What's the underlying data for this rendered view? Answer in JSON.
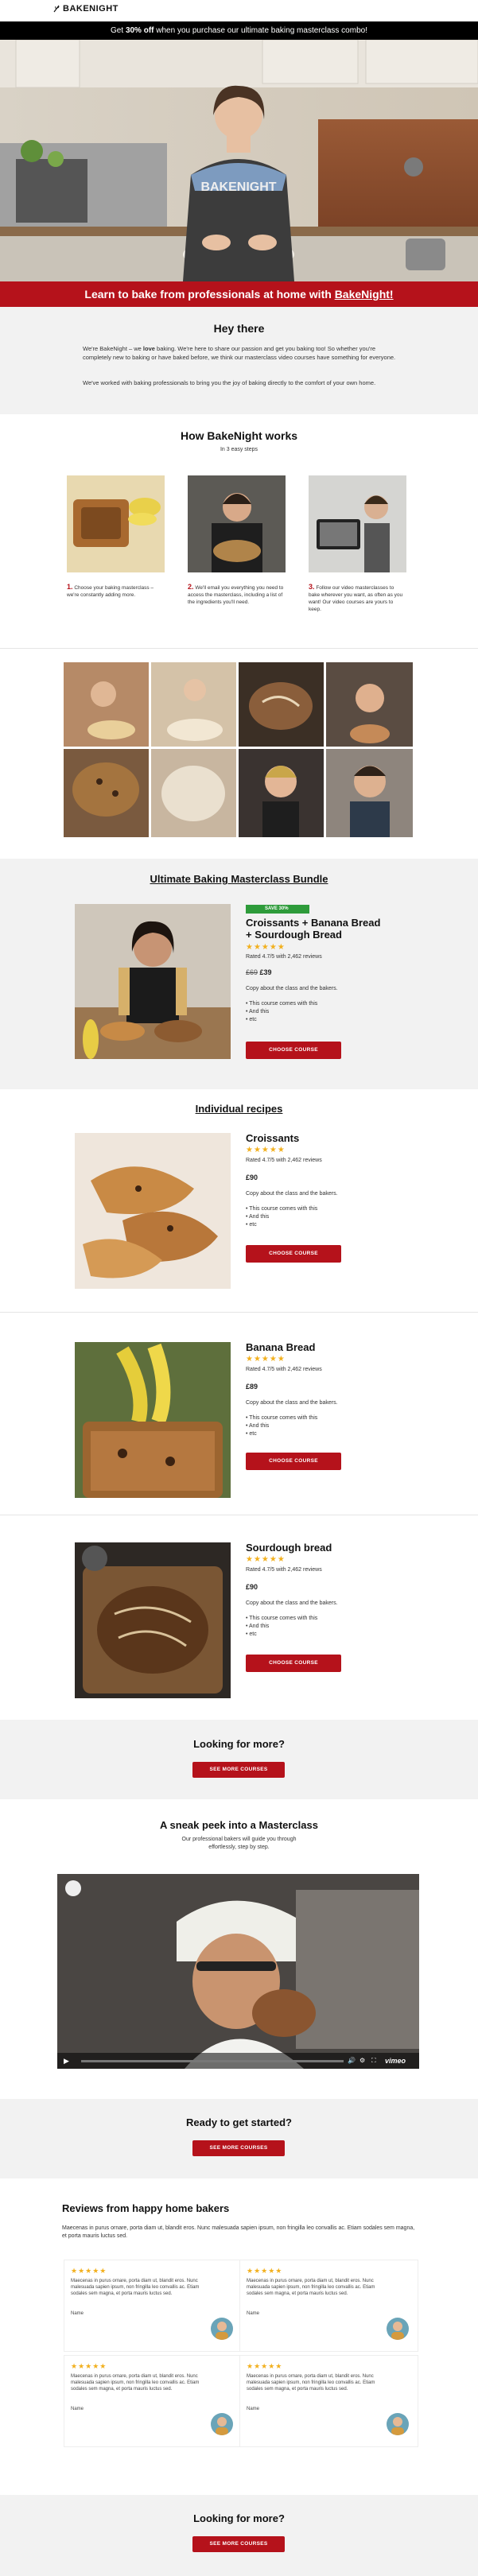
{
  "brand": {
    "name": "BAKENIGHT"
  },
  "promo": {
    "prefix": "Get ",
    "highlight": "30% off",
    "suffix": " when you purchase our ultimate baking masterclass combo!"
  },
  "hero": {
    "apron_text": "BAKENIGHT"
  },
  "banner": {
    "text": "Learn to bake from professionals at home with ",
    "link": "BakeNight!"
  },
  "intro": {
    "title": "Hey there",
    "p1_pre": "We're BakeNight – we ",
    "p1_bold": "love",
    "p1_post": " baking. We're here to share our passion and get you baking too! So whether you're completely new to baking or have baked before, we think our masterclass video courses have something for everyone.",
    "p2": "We've worked with baking professionals to bring you the joy of baking directly to the comfort of your own home."
  },
  "how": {
    "title": "How BakeNight works",
    "subtitle": "In 3 easy steps",
    "steps": [
      {
        "num": "1.",
        "text": "Choose your baking masterclass – we're constantly adding more."
      },
      {
        "num": "2.",
        "text": "We'll email you everything you need to access the masterclass, including a list of the ingredients you'll need."
      },
      {
        "num": "3.",
        "text": "Follow our video masterclasses to bake wherever you want, as often as you want! Our video courses are yours to keep."
      }
    ]
  },
  "bundle": {
    "heading": "Ultimate Baking Masterclass Bundle",
    "badge": "SAVE 30%",
    "title_line1": "Croissants + Banana Bread",
    "title_line2": "+ Sourdough Bread",
    "stars": "★★★★★",
    "rating": "Rated 4.7/5 with 2,462 reviews",
    "old_price": "£69",
    "price": "£39",
    "description": "Copy about the class and the bakers.",
    "bullets": [
      "This course comes with this",
      "And this",
      "etc"
    ],
    "button": "CHOOSE COURSE"
  },
  "individual": {
    "heading": "Individual recipes",
    "products": [
      {
        "title": "Croissants",
        "stars": "★★★★★",
        "rating": "Rated 4.7/5 with 2,462 reviews",
        "price": "£90",
        "description": "Copy about the class and the bakers.",
        "bullets": [
          "This course comes with this",
          "And this",
          "etc"
        ],
        "button": "CHOOSE COURSE"
      },
      {
        "title": "Banana Bread",
        "stars": "★★★★★",
        "rating": "Rated 4.7/5 with 2,462 reviews",
        "price": "£89",
        "description": "Copy about the class and the bakers.",
        "bullets": [
          "This course comes with this",
          "And this",
          "etc"
        ],
        "button": "CHOOSE COURSE"
      },
      {
        "title": "Sourdough bread",
        "stars": "★★★★★",
        "rating": "Rated 4.7/5 with 2,462 reviews",
        "price": "£90",
        "description": "Copy about the class and the bakers.",
        "bullets": [
          "This course comes with this",
          "And this",
          "etc"
        ],
        "button": "CHOOSE COURSE"
      }
    ]
  },
  "more1": {
    "title": "Looking for more?",
    "button": "SEE MORE COURSES"
  },
  "peek": {
    "title": "A sneak peek into a Masterclass",
    "subtitle_line1": "Our professional bakers will guide you through",
    "subtitle_line2": "effortlessly, step by step.",
    "player_brand": "vimeo"
  },
  "ready": {
    "title": "Ready to get started?",
    "button": "SEE MORE COURSES"
  },
  "reviews": {
    "title": "Reviews from happy home bakers",
    "intro": "Maecenas in purus ornare, porta diam ut, blandit eros. Nunc malesuada sapien ipsum, non fringilla leo convallis ac. Etiam sodales sem magna, et porta mauris luctus sed.",
    "items": [
      {
        "stars": "★★★★★",
        "text": "Maecenas in purus ornare, porta diam ut, blandit eros. Nunc malesuada sapien ipsum, non fringilla leo convallis ac. Etiam sodales sem magna, et porta mauris luctus sed.",
        "name": "Name"
      },
      {
        "stars": "★★★★★",
        "text": "Maecenas in purus ornare, porta diam ut, blandit eros. Nunc malesuada sapien ipsum, non fringilla leo convallis ac. Etiam sodales sem magna, et porta mauris luctus sed.",
        "name": "Name"
      },
      {
        "stars": "★★★★★",
        "text": "Maecenas in purus ornare, porta diam ut, blandit eros. Nunc malesuada sapien ipsum, non fringilla leo convallis ac. Etiam sodales sem magna, et porta mauris luctus sed.",
        "name": "Name"
      },
      {
        "stars": "★★★★★",
        "text": "Maecenas in purus ornare, porta diam ut, blandit eros. Nunc malesuada sapien ipsum, non fringilla leo convallis ac. Etiam sodales sem magna, et porta mauris luctus sed.",
        "name": "Name"
      }
    ]
  },
  "more2": {
    "title": "Looking for more?",
    "button": "SEE MORE COURSES"
  },
  "colors": {
    "brand_red": "#b5121b",
    "star_gold": "#f2b01e",
    "badge_green": "#2e9b3a",
    "section_grey": "#f2f2f2"
  }
}
